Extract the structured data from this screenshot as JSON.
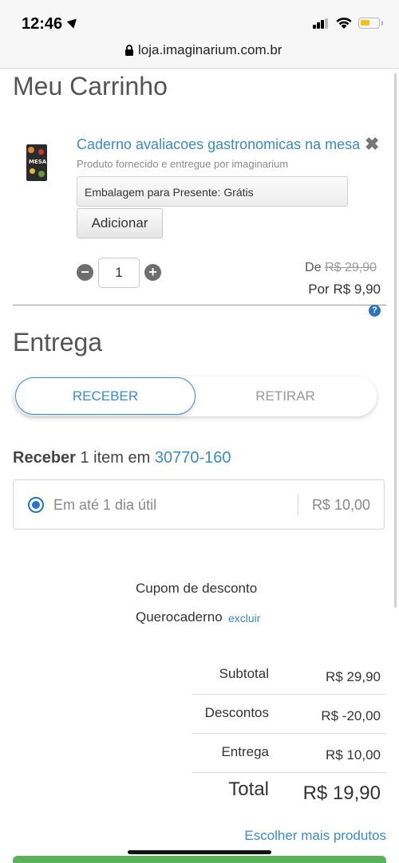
{
  "status_bar": {
    "time": "12:46"
  },
  "browser": {
    "url": "loja.imaginarium.com.br"
  },
  "cart": {
    "title": "Meu Carrinho",
    "item": {
      "thumbnail_text": "MESA",
      "name": "Caderno avaliacoes gastronomicas na mesa",
      "seller": "Produto fornecido e entregue por imaginarium",
      "gift_wrap": "Embalagem para Presente: Grátis",
      "add_label": "Adicionar",
      "quantity": "1",
      "price_from_label": "De",
      "price_from": "R$ 29,90",
      "price_now": "Por R$ 9,90"
    }
  },
  "delivery": {
    "title": "Entrega",
    "tabs": [
      {
        "label": "RECEBER",
        "active": true
      },
      {
        "label": "RETIRAR",
        "active": false
      }
    ],
    "receive_prefix": "Receber",
    "receive_middle": "1 item em",
    "postal_code": "30770-160",
    "option": {
      "text": "Em até 1 dia útil",
      "price": "R$ 10,00",
      "selected": true
    }
  },
  "coupon": {
    "label": "Cupom de desconto",
    "code": "Querocaderno",
    "remove_label": "excluir"
  },
  "summary": {
    "rows": [
      {
        "label": "Subtotal",
        "value": "R$ 29,90"
      },
      {
        "label": "Descontos",
        "value": "R$ -20,00"
      },
      {
        "label": "Entrega",
        "value": "R$ 10,00"
      }
    ],
    "total_label": "Total",
    "total_value": "R$ 19,90"
  },
  "more_products": "Escolher mais produtos",
  "colors": {
    "link": "#3b8bc7",
    "radio": "#2a74c5",
    "checkout": "#5bb25a"
  }
}
